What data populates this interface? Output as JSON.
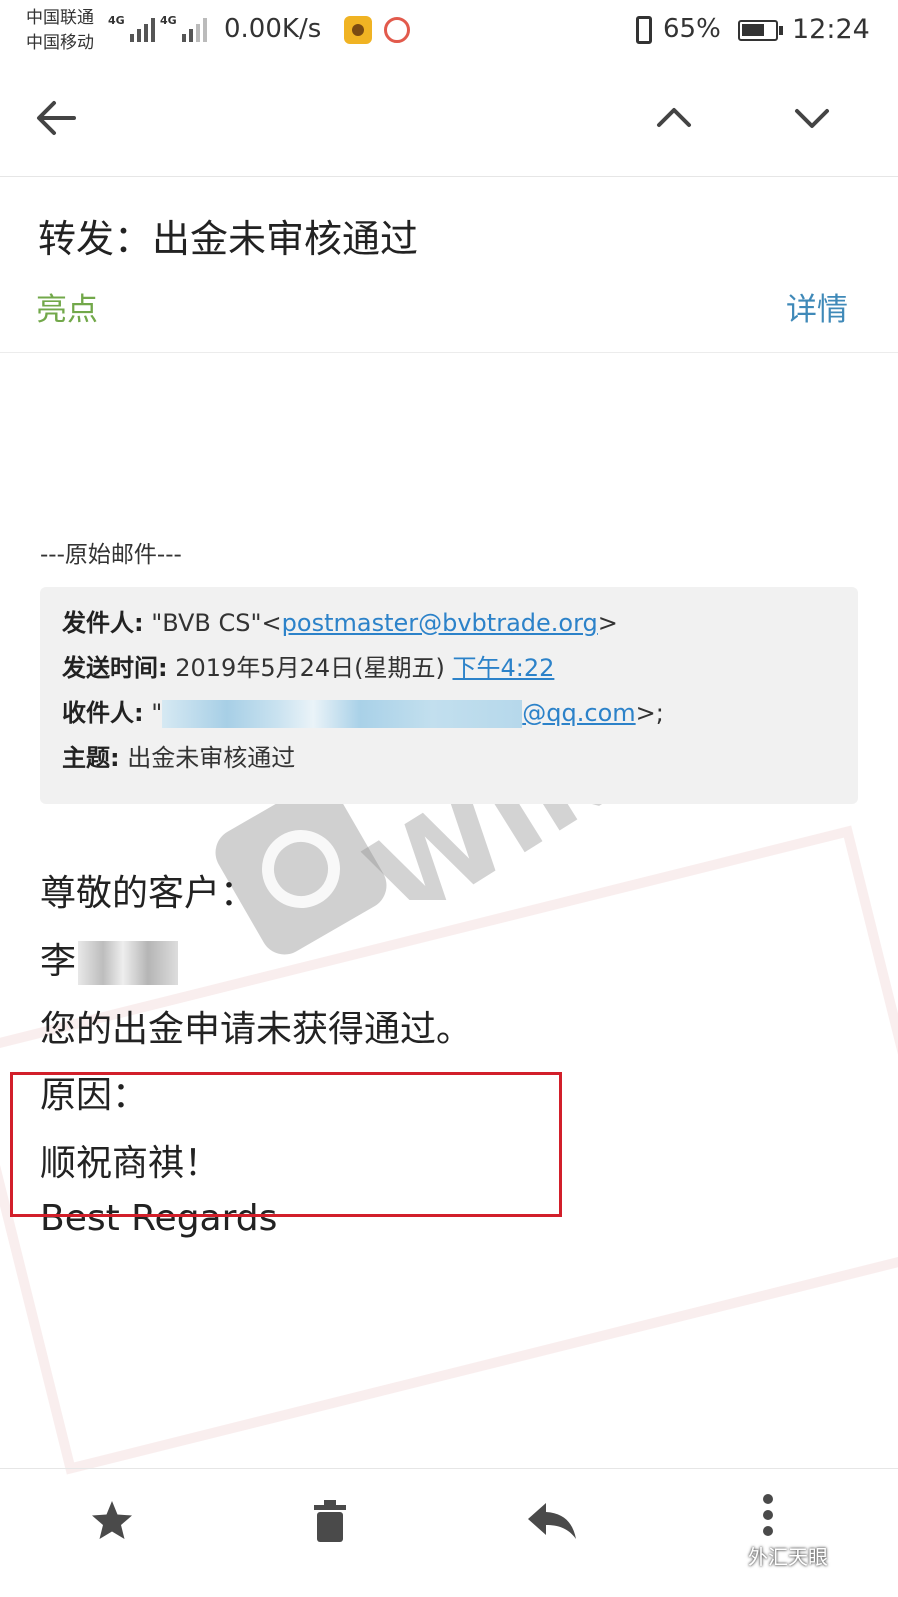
{
  "status_bar": {
    "carrier_1": "中国联通",
    "carrier_2": "中国移动",
    "network_1": "4G",
    "network_2": "4G",
    "net_speed": "0.00K/s",
    "battery": "65%",
    "time": "12:24"
  },
  "toolbar": {
    "back_icon": "arrow-left-icon",
    "prev_icon": "chevron-up-icon",
    "next_icon": "chevron-down-icon"
  },
  "email": {
    "subject": "转发：出金未审核通过",
    "tag_label": "亮点",
    "details_label": "详情",
    "original_label": "---原始邮件---",
    "quote": {
      "from_label": "发件人:",
      "from_name": " \"BVB CS\"<",
      "from_email": "postmaster@bvbtrade.org",
      "from_end": ">",
      "sent_label": "发送时间:",
      "sent_date": " 2019年5月24日(星期五) ",
      "sent_time": "下午4:22",
      "to_label": "收件人:",
      "to_prefix": " \"",
      "to_domain": "@qq.com",
      "to_end": ">;",
      "subject_label": "主题:",
      "subject_value": " 出金未审核通过"
    },
    "body": {
      "greeting": "尊敬的客户：",
      "name_prefix": "李",
      "message": "您的出金申请未获得通过。",
      "reason_label": "原因：",
      "reason_text": "顺祝商祺！",
      "closing": "Best Regards"
    },
    "watermark": "WikiFX"
  },
  "bottom_bar": {
    "star_icon": "star-icon",
    "delete_icon": "trash-icon",
    "reply_icon": "reply-icon",
    "more_icon": "more-vertical-icon",
    "brand": "外汇天眼"
  },
  "colors": {
    "highlight_green": "#72a84a",
    "details_blue": "#3f89b8",
    "link_blue": "#2c82c9",
    "highlight_box_red": "#d21f2a"
  }
}
